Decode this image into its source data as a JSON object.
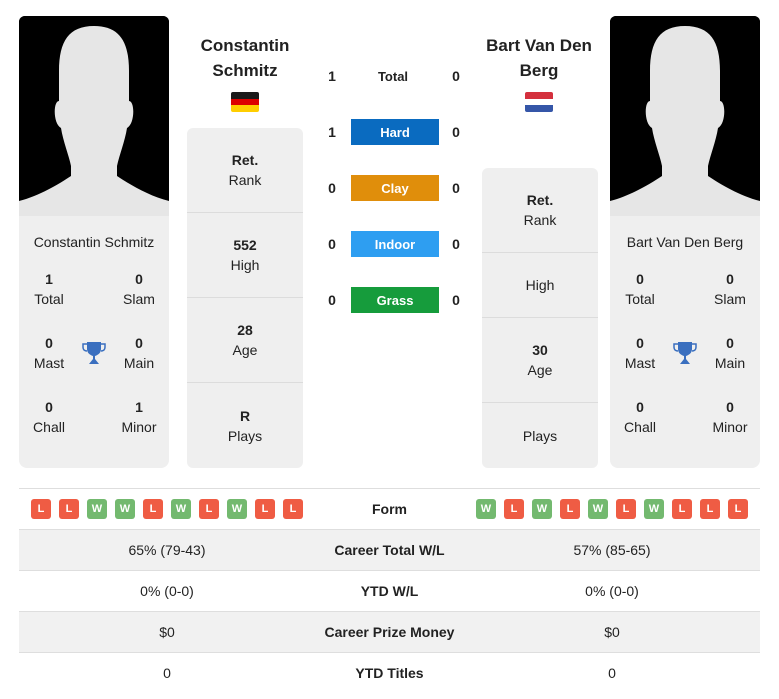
{
  "player1": {
    "name_line1": "Constantin",
    "name_line2": "Schmitz",
    "full_name": "Constantin Schmitz",
    "country_flag": "germany-flag",
    "info": [
      {
        "value": "Ret.",
        "label": "Rank"
      },
      {
        "value": "552",
        "label": "High"
      },
      {
        "value": "28",
        "label": "Age"
      },
      {
        "value": "R",
        "label": "Plays"
      }
    ],
    "titles": {
      "total": "1",
      "total_label": "Total",
      "slam": "0",
      "slam_label": "Slam",
      "mast": "0",
      "mast_label": "Mast",
      "main": "0",
      "main_label": "Main",
      "chall": "0",
      "chall_label": "Chall",
      "minor": "1",
      "minor_label": "Minor"
    },
    "form": [
      "L",
      "L",
      "W",
      "W",
      "L",
      "W",
      "L",
      "W",
      "L",
      "L"
    ]
  },
  "player2": {
    "name_line1": "Bart Van Den",
    "name_line2": "Berg",
    "full_name": "Bart Van Den Berg",
    "country_flag": "netherlands-flag",
    "info": [
      {
        "value": "Ret.",
        "label": "Rank"
      },
      {
        "value": "",
        "label": "High"
      },
      {
        "value": "30",
        "label": "Age"
      },
      {
        "value": "",
        "label": "Plays"
      }
    ],
    "titles": {
      "total": "0",
      "total_label": "Total",
      "slam": "0",
      "slam_label": "Slam",
      "mast": "0",
      "mast_label": "Mast",
      "main": "0",
      "main_label": "Main",
      "chall": "0",
      "chall_label": "Chall",
      "minor": "0",
      "minor_label": "Minor"
    },
    "form": [
      "W",
      "L",
      "W",
      "L",
      "W",
      "L",
      "W",
      "L",
      "L",
      "L"
    ]
  },
  "h2h": [
    {
      "label": "Total",
      "p1": "1",
      "p2": "0",
      "color": ""
    },
    {
      "label": "Hard",
      "p1": "1",
      "p2": "0",
      "color": "#0a6bc0"
    },
    {
      "label": "Clay",
      "p1": "0",
      "p2": "0",
      "color": "#e08e0b"
    },
    {
      "label": "Indoor",
      "p1": "0",
      "p2": "0",
      "color": "#2e9ef1"
    },
    {
      "label": "Grass",
      "p1": "0",
      "p2": "0",
      "color": "#169c3c"
    }
  ],
  "colors": {
    "win": "#73b96f",
    "loss": "#ef5c44",
    "trophy": "#3a6fbf"
  },
  "table": {
    "form_label": "Form",
    "rows": [
      {
        "label": "Career Total W/L",
        "p1": "65% (79-43)",
        "p2": "57% (85-65)"
      },
      {
        "label": "YTD W/L",
        "p1": "0% (0-0)",
        "p2": "0% (0-0)"
      },
      {
        "label": "Career Prize Money",
        "p1": "$0",
        "p2": "$0"
      },
      {
        "label": "YTD Titles",
        "p1": "0",
        "p2": "0"
      }
    ]
  }
}
